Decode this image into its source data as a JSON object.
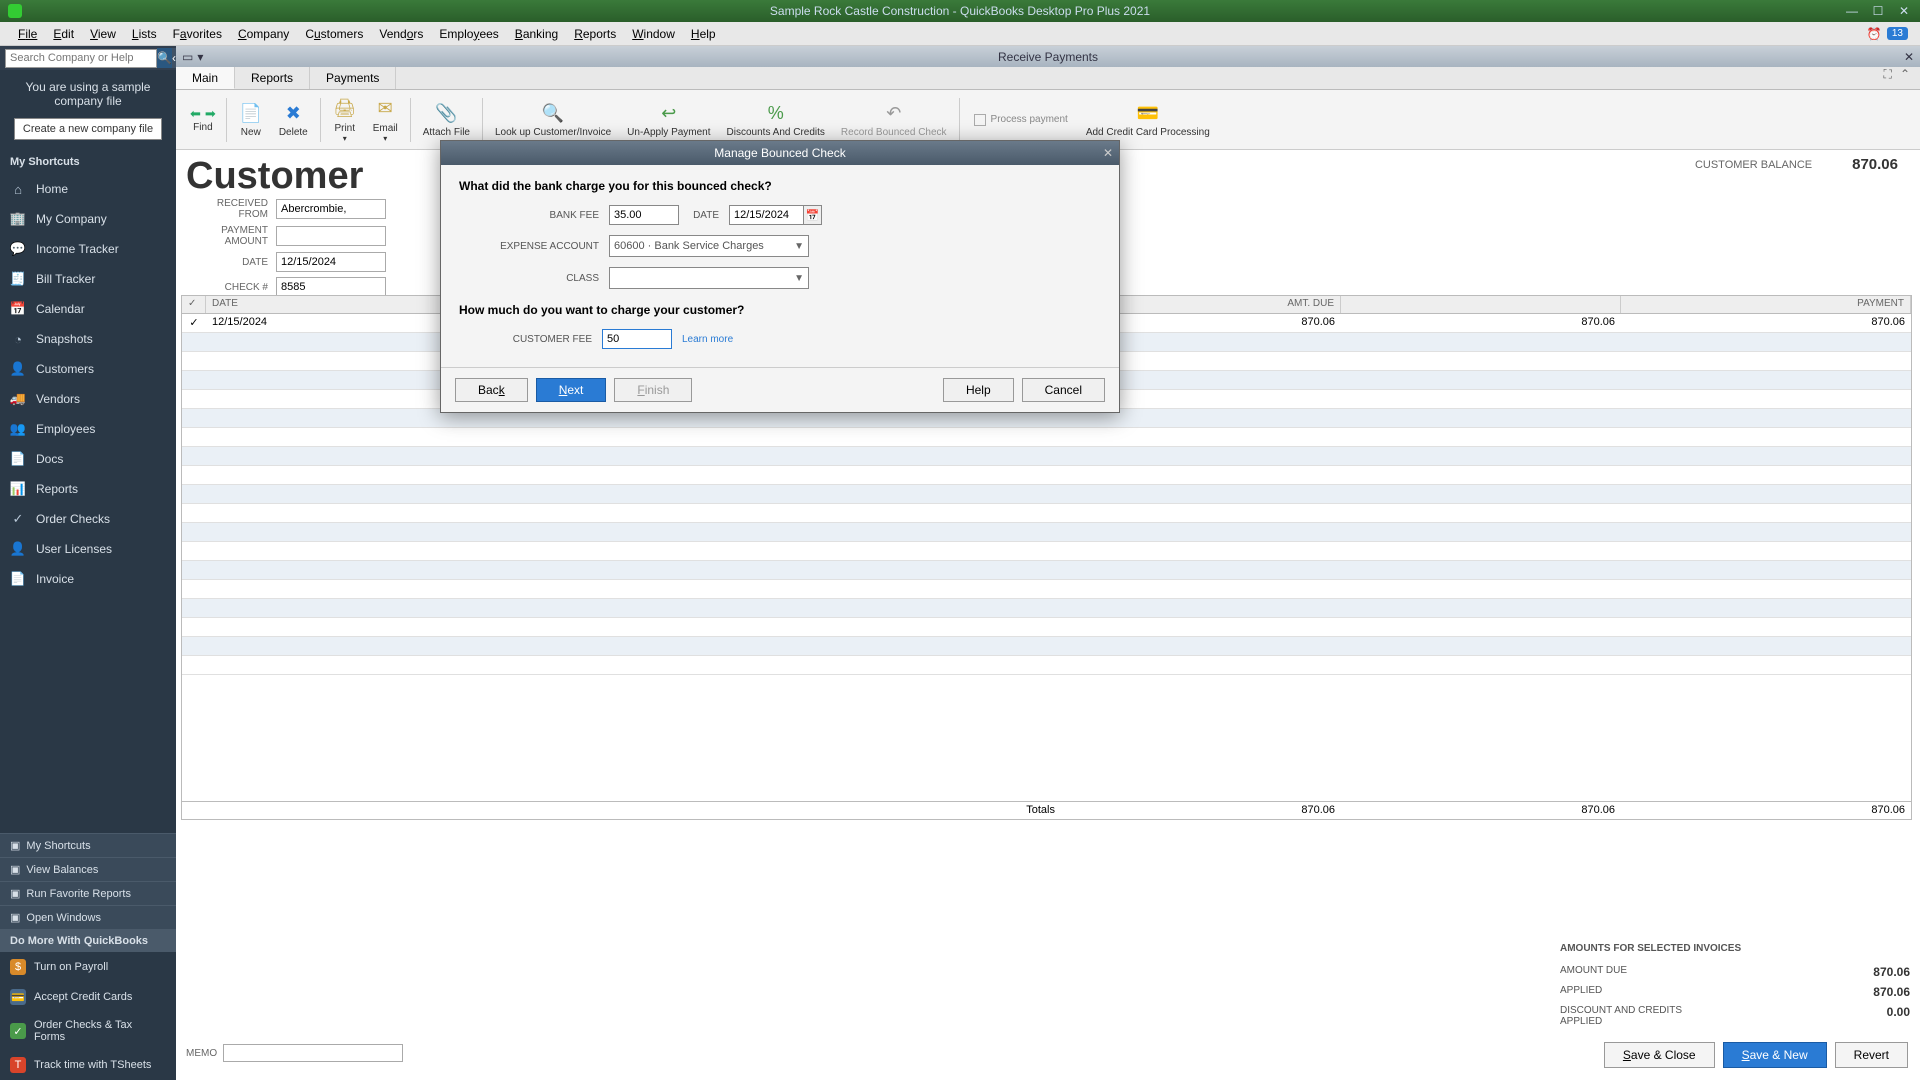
{
  "titlebar": {
    "title": "Sample Rock Castle Construction  - QuickBooks Desktop Pro Plus 2021"
  },
  "menubar": {
    "file": "File",
    "edit": "Edit",
    "view": "View",
    "lists": "Lists",
    "favorites": "Favorites",
    "company": "Company",
    "customers": "Customers",
    "vendors": "Vendors",
    "employees": "Employees",
    "banking": "Banking",
    "reports": "Reports",
    "window": "Window",
    "help": "Help",
    "badge": "13"
  },
  "search": {
    "placeholder": "Search Company or Help"
  },
  "sidebar": {
    "notice1": "You are using a sample",
    "notice2": "company file",
    "newco": "Create a new company file",
    "myShortcuts": "My Shortcuts",
    "items": [
      {
        "icon": "⌂",
        "label": "Home"
      },
      {
        "icon": "🏢",
        "label": "My Company"
      },
      {
        "icon": "💬",
        "label": "Income Tracker"
      },
      {
        "icon": "🧾",
        "label": "Bill Tracker"
      },
      {
        "icon": "📅",
        "label": "Calendar"
      },
      {
        "icon": "◔",
        "label": "Snapshots"
      },
      {
        "icon": "👤",
        "label": "Customers"
      },
      {
        "icon": "🚚",
        "label": "Vendors"
      },
      {
        "icon": "👥",
        "label": "Employees"
      },
      {
        "icon": "📄",
        "label": "Docs"
      },
      {
        "icon": "📊",
        "label": "Reports"
      },
      {
        "icon": "✓",
        "label": "Order Checks"
      },
      {
        "icon": "👤",
        "label": "User Licenses"
      },
      {
        "icon": "📄",
        "label": "Invoice"
      }
    ],
    "footer": {
      "shortcuts": "My Shortcuts",
      "viewbal": "View Balances",
      "runfav": "Run Favorite Reports",
      "openwin": "Open Windows",
      "domore": "Do More With QuickBooks",
      "fitems": [
        {
          "label": "Turn on Payroll",
          "color": "#d88a2a"
        },
        {
          "label": "Accept Credit Cards",
          "color": "#4a6a8a"
        },
        {
          "label": "Order Checks & Tax Forms",
          "color": "#4a9a4a"
        },
        {
          "label": "Track time with TSheets",
          "color": "#d8442a"
        }
      ]
    }
  },
  "subwindow": {
    "title": "Receive Payments"
  },
  "tabs": {
    "main": "Main",
    "reports": "Reports",
    "payments": "Payments"
  },
  "toolbar": {
    "find": "Find",
    "new": "New",
    "delete": "Delete",
    "print": "Print",
    "email": "Email",
    "attach": "Attach File",
    "lookup": "Look up Customer/Invoice",
    "unapply": "Un-Apply Payment",
    "discounts": "Discounts And Credits",
    "record": "Record Bounced Check",
    "process": "Process payment",
    "addcc": "Add Credit Card Processing"
  },
  "header": {
    "title": "Customer",
    "balLabel": "CUSTOMER BALANCE",
    "balVal": "870.06"
  },
  "form": {
    "receivedFromL": "RECEIVED FROM",
    "receivedFrom": "Abercrombie,",
    "paymentAmountL": "PAYMENT AMOUNT",
    "dateL": "DATE",
    "date": "12/15/2024",
    "checkL": "CHECK #",
    "check": "8585"
  },
  "table": {
    "hDate": "DATE",
    "hAmt": "AMT. DUE",
    "hPay": "PAYMENT",
    "row": {
      "date": "12/15/2024",
      "amt1": "870.06",
      "amt2": "870.06",
      "pay": "870.06"
    },
    "totals": "Totals",
    "t1": "870.06",
    "t2": "870.06",
    "t3": "870.06"
  },
  "summary": {
    "title": "AMOUNTS FOR SELECTED INVOICES",
    "amtDueL": "AMOUNT DUE",
    "amtDue": "870.06",
    "appliedL": "APPLIED",
    "applied": "870.06",
    "discL": "DISCOUNT AND CREDITS APPLIED",
    "disc": "0.00"
  },
  "memoL": "MEMO",
  "actions": {
    "saveClose": "Save & Close",
    "saveNew": "Save & New",
    "revert": "Revert"
  },
  "modal": {
    "title": "Manage Bounced Check",
    "q1": "What did the bank charge you for this bounced check?",
    "bankFeeL": "BANK FEE",
    "bankFee": "35.00",
    "dateL": "DATE",
    "date": "12/15/2024",
    "expAcctL": "EXPENSE ACCOUNT",
    "expAcct": "60600 · Bank Service Charges",
    "classL": "CLASS",
    "q2": "How much do you want to charge your customer?",
    "custFeeL": "CUSTOMER FEE",
    "custFee": "50",
    "learn": "Learn more",
    "back": "Back",
    "next": "Next",
    "finish": "Finish",
    "help": "Help",
    "cancel": "Cancel"
  }
}
